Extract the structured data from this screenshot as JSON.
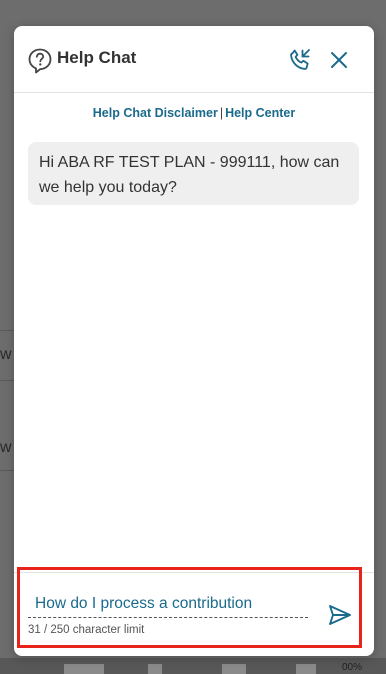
{
  "background": {
    "fragments": [
      "w",
      "w"
    ],
    "zoom_text": "00%"
  },
  "header": {
    "title": "Help Chat",
    "icons": {
      "help": "question-bubble-icon",
      "phone": "phone-callback-icon",
      "close": "close-icon"
    }
  },
  "links": {
    "disclaimer": "Help Chat Disclaimer",
    "separator": "|",
    "help_center": "Help Center"
  },
  "messages": [
    {
      "from": "agent",
      "text": "Hi ABA RF TEST PLAN - 999111, how can we help you today?"
    }
  ],
  "composer": {
    "value": "How do I process a contribution",
    "count": "31 / 250 character limit",
    "send_icon": "send-icon"
  },
  "colors": {
    "accent": "#1a6a8c",
    "highlight": "#e8231a",
    "bubble": "#efefef",
    "backdrop": "#6d6d6d"
  }
}
